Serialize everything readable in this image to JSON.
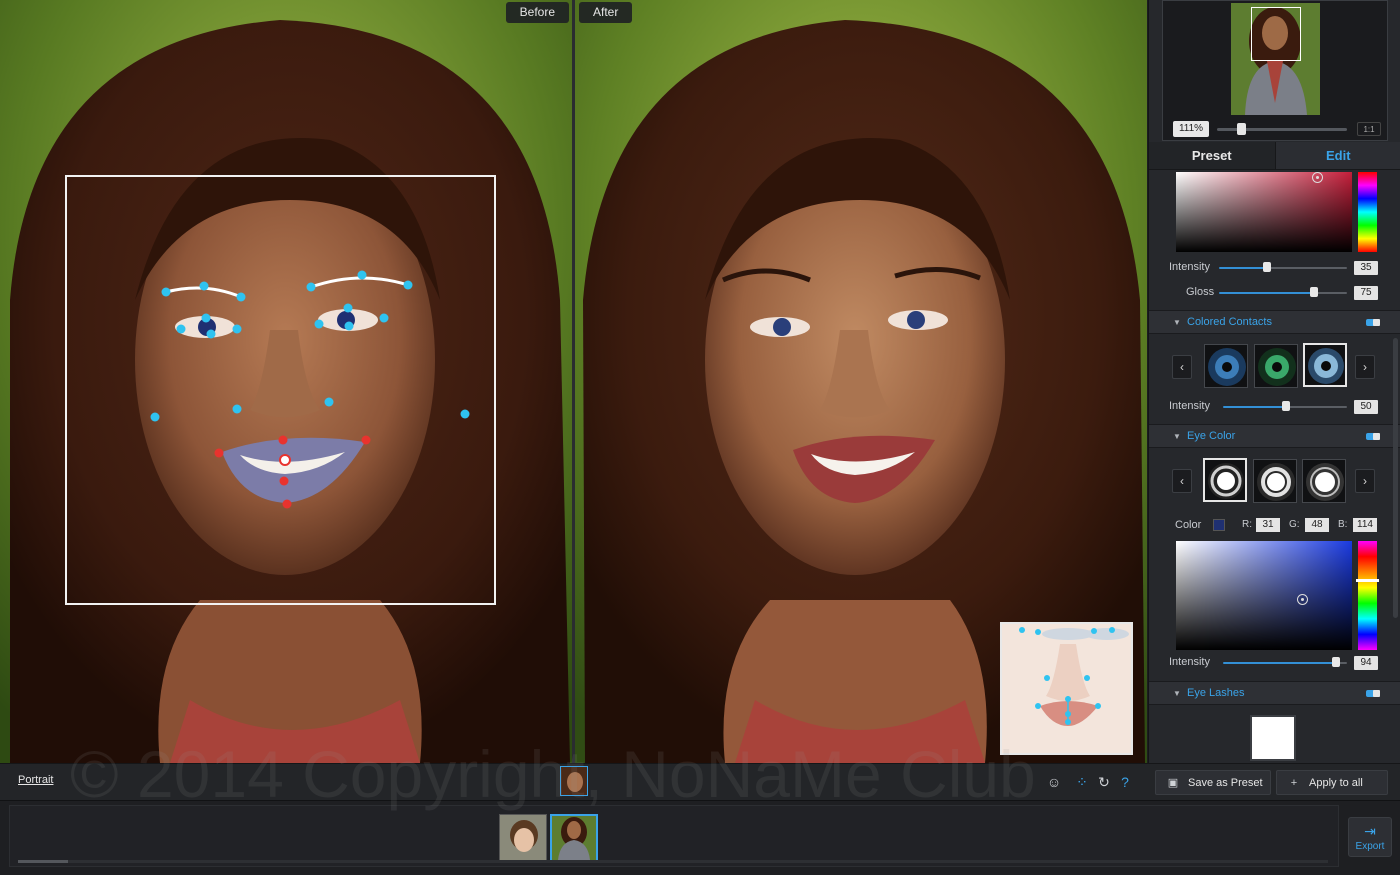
{
  "view": {
    "before_label": "Before",
    "after_label": "After"
  },
  "navigator": {
    "zoom": "111%",
    "one_to_one": "1:1",
    "zoom_level": 0.2
  },
  "tabs": [
    {
      "label": "Preset",
      "active": false
    },
    {
      "label": "Edit",
      "active": true
    }
  ],
  "lipstick": {
    "intensity_label": "Intensity",
    "intensity": "35",
    "gloss_label": "Gloss",
    "gloss": "75",
    "color": "#c41e3a"
  },
  "colored_contacts": {
    "title": "Colored Contacts",
    "enabled": true,
    "intensity_label": "Intensity",
    "intensity": "50",
    "prev": "‹",
    "next": "›",
    "swatch_icons": [
      "blue-iris-icon",
      "green-iris-icon",
      "light-blue-iris-icon"
    ],
    "selected_index": 2
  },
  "eye_color": {
    "title": "Eye Color",
    "enabled": true,
    "color_label": "Color",
    "r_label": "R:",
    "r": "31",
    "g_label": "G:",
    "g": "48",
    "b_label": "B:",
    "b": "114",
    "intensity_label": "Intensity",
    "intensity": "94",
    "prev": "‹",
    "next": "›",
    "swatch_icons": [
      "iris-ring-dark-icon",
      "iris-ring-medium-icon",
      "iris-ring-light-icon"
    ],
    "selected_index": 0,
    "color": "#1f3072"
  },
  "eye_lashes": {
    "title": "Eye Lashes",
    "enabled": true
  },
  "toolbar": {
    "portrait_link": "Portrait",
    "save_preset": "Save as Preset",
    "apply_all": "Apply to all",
    "help": "?",
    "icons": [
      "face-detect-icon",
      "landmarks-icon",
      "reset-icon",
      "help-icon"
    ]
  },
  "filmstrip": {
    "export_label": "Export",
    "thumbnails": [
      "boy-portrait-thumb",
      "woman-portrait-thumb"
    ],
    "selected_index": 1
  },
  "watermark": "© 2014 Copyright, NoNaMe Club",
  "colors": {
    "accent": "#3aa3e8",
    "landmark_blue": "#2fc3f0",
    "landmark_red": "#e8332e",
    "panel_bg": "#26282c"
  }
}
